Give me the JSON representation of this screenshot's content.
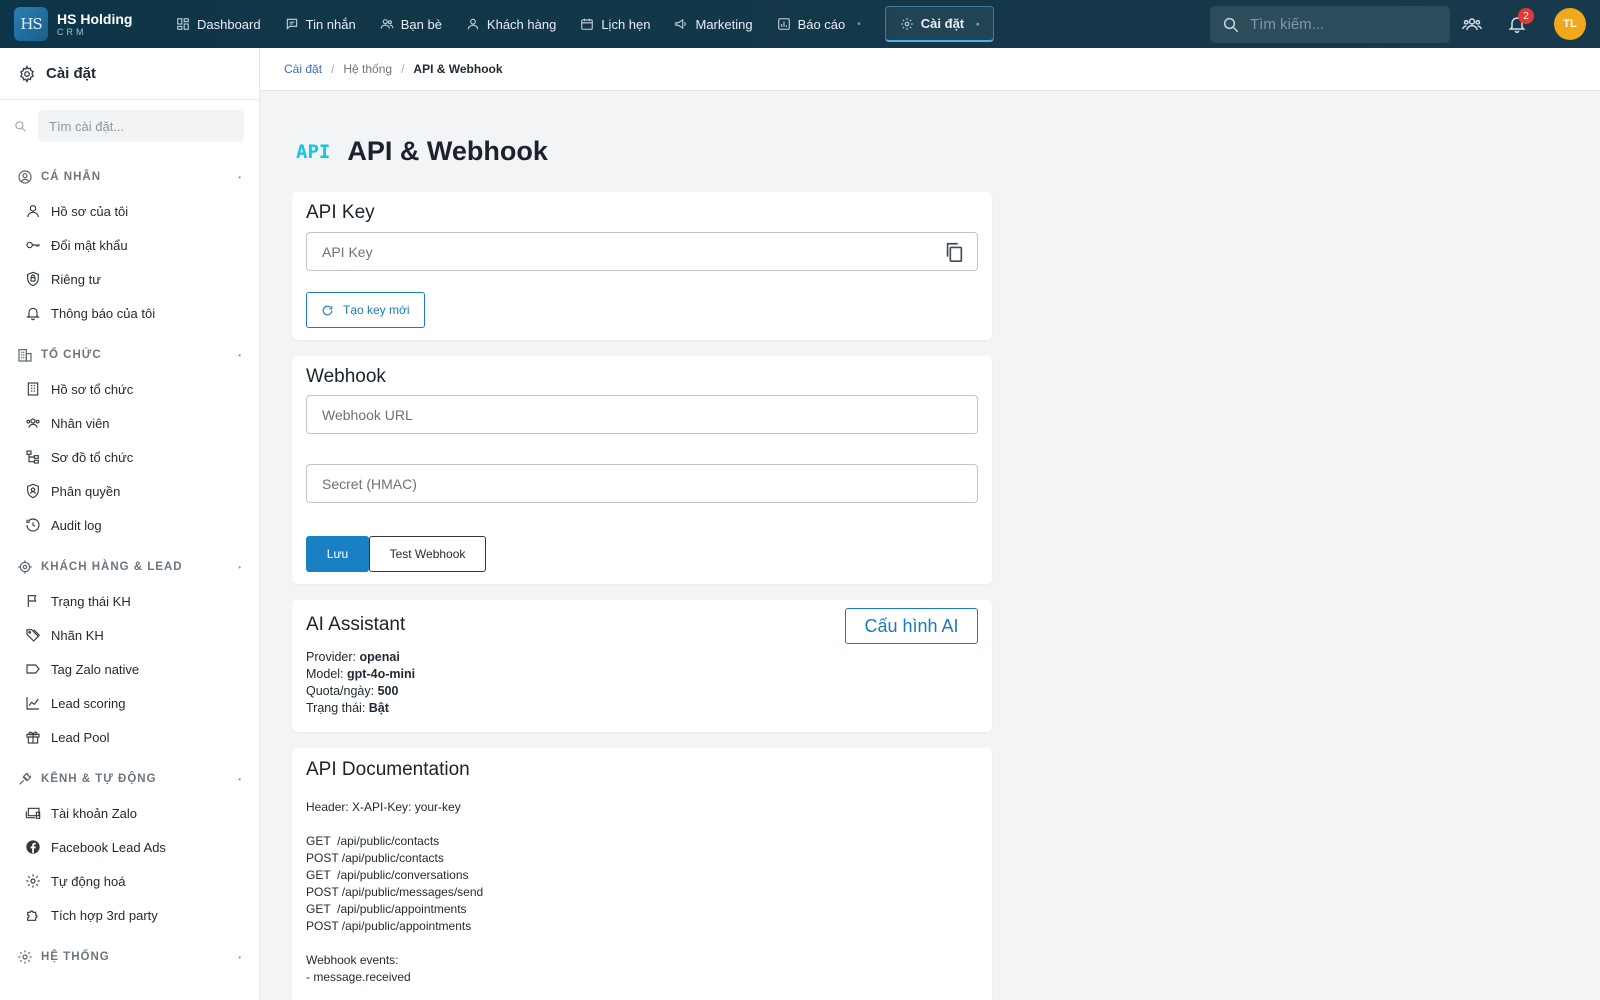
{
  "brand": {
    "logo": "HS",
    "name": "HS Holding",
    "sub": "CRM"
  },
  "nav": {
    "items": [
      {
        "label": "Dashboard",
        "icon": "dashboard-icon"
      },
      {
        "label": "Tin nhắn",
        "icon": "message-icon"
      },
      {
        "label": "Bạn bè",
        "icon": "friends-icon"
      },
      {
        "label": "Khách hàng",
        "icon": "customer-icon"
      },
      {
        "label": "Lịch hẹn",
        "icon": "calendar-icon"
      },
      {
        "label": "Marketing",
        "icon": "megaphone-icon"
      },
      {
        "label": "Báo cáo",
        "icon": "report-icon"
      }
    ],
    "active": {
      "label": "Cài đặt",
      "icon": "gear-icon"
    }
  },
  "top": {
    "search_placeholder": "Tìm kiếm...",
    "notification_count": "2",
    "avatar": "TL"
  },
  "sidebar": {
    "title": "Cài đặt",
    "search_placeholder": "Tìm cài đặt...",
    "sections": [
      {
        "label": "CÁ NHÂN",
        "items": [
          "Hồ sơ của tôi",
          "Đổi mật khẩu",
          "Riêng tư",
          "Thông báo của tôi"
        ]
      },
      {
        "label": "TỔ CHỨC",
        "items": [
          "Hồ sơ tổ chức",
          "Nhân viên",
          "Sơ đồ tổ chức",
          "Phân quyền",
          "Audit log"
        ]
      },
      {
        "label": "KHÁCH HÀNG & LEAD",
        "items": [
          "Trạng thái KH",
          "Nhãn KH",
          "Tag Zalo native",
          "Lead scoring",
          "Lead Pool"
        ]
      },
      {
        "label": "KÊNH & TỰ ĐỘNG",
        "items": [
          "Tài khoản Zalo",
          "Facebook Lead Ads",
          "Tự động hoá",
          "Tích hợp 3rd party"
        ]
      },
      {
        "label": "HỆ THỐNG",
        "items": []
      }
    ]
  },
  "breadcrumb": {
    "root": "Cài đặt",
    "mid": "Hệ thống",
    "current": "API & Webhook"
  },
  "page": {
    "icon_text": "API",
    "title": "API & Webhook"
  },
  "api_key": {
    "title": "API Key",
    "placeholder": "API Key",
    "regen_label": "Tạo key mới"
  },
  "webhook": {
    "title": "Webhook",
    "url_placeholder": "Webhook URL",
    "secret_placeholder": "Secret (HMAC)",
    "save_label": "Lưu",
    "test_label": "Test Webhook"
  },
  "ai": {
    "title": "AI Assistant",
    "config_label": "Cấu hình AI",
    "provider_label": "Provider:",
    "provider": "openai",
    "model_label": "Model:",
    "model": "gpt-4o-mini",
    "quota_label": "Quota/ngày:",
    "quota": "500",
    "status_label": "Trạng thái:",
    "status": "Bật"
  },
  "docs": {
    "title": "API Documentation",
    "lines": [
      "Header: X-API-Key: your-key",
      "",
      "GET  /api/public/contacts",
      "POST /api/public/contacts",
      "GET  /api/public/conversations",
      "POST /api/public/messages/send",
      "GET  /api/public/appointments",
      "POST /api/public/appointments",
      "",
      "Webhook events:",
      "- message.received"
    ]
  },
  "colors": {
    "topbar": "#14384a",
    "accent": "#1a80c4",
    "api_icon": "#14c5e0",
    "avatar": "#f0a81c",
    "badge": "#e53935"
  }
}
